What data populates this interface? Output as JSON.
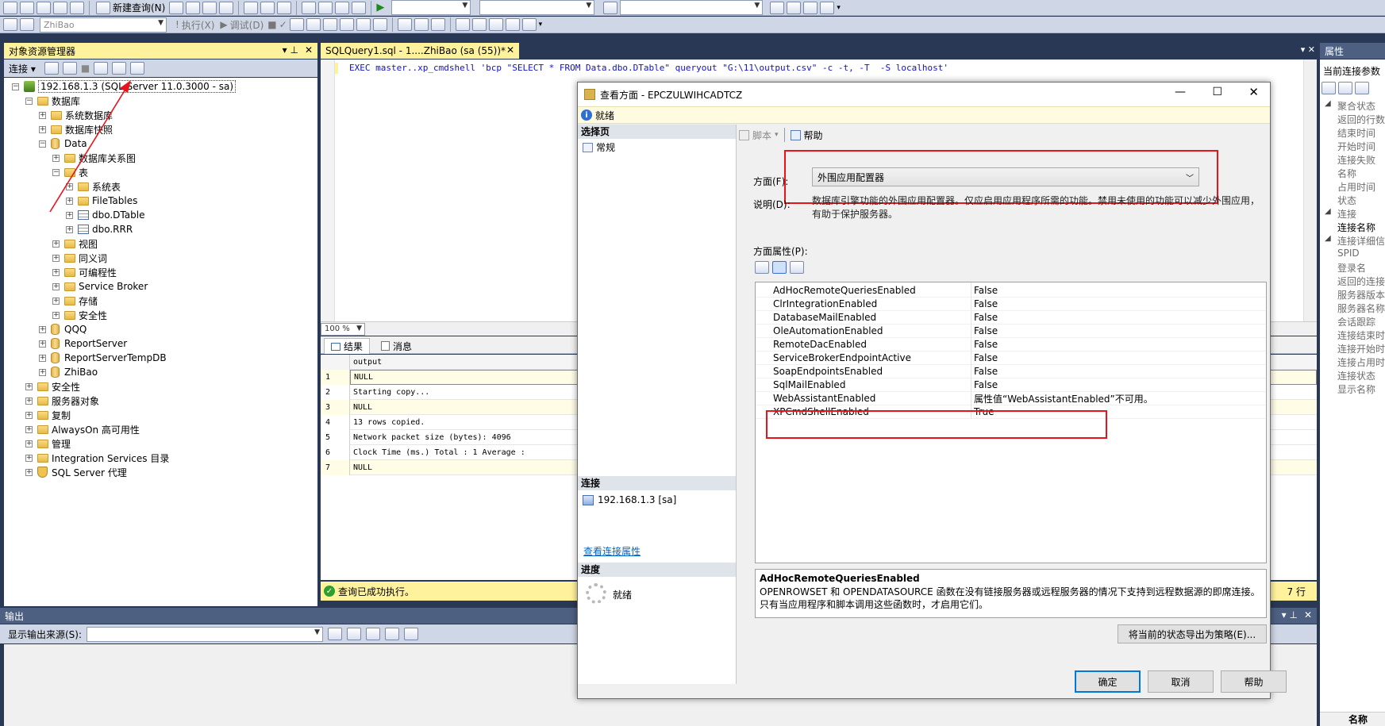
{
  "toolbar1": {
    "new_query": "新建查询(N)"
  },
  "toolbar2": {
    "database_combo": "ZhiBao",
    "execute": "执行(X)",
    "debug": "调试(D)"
  },
  "object_explorer": {
    "title": "对象资源管理器",
    "connect_label": "连接 ▾",
    "tree": [
      {
        "label": "192.168.1.3 (SQL Server 11.0.3000 - sa)",
        "level": 0,
        "icon": "server-icon",
        "state": "-"
      },
      {
        "label": "数据库",
        "level": 1,
        "icon": "folder-icon",
        "state": "-"
      },
      {
        "label": "系统数据库",
        "level": 2,
        "icon": "folder-icon",
        "state": "+"
      },
      {
        "label": "数据库快照",
        "level": 2,
        "icon": "folder-icon",
        "state": "+"
      },
      {
        "label": "Data",
        "level": 2,
        "icon": "database-icon",
        "state": "-"
      },
      {
        "label": "数据库关系图",
        "level": 3,
        "icon": "folder-icon",
        "state": "+"
      },
      {
        "label": "表",
        "level": 3,
        "icon": "folder-icon",
        "state": "-"
      },
      {
        "label": "系统表",
        "level": 4,
        "icon": "folder-icon",
        "state": "+"
      },
      {
        "label": "FileTables",
        "level": 4,
        "icon": "folder-icon",
        "state": "+"
      },
      {
        "label": "dbo.DTable",
        "level": 4,
        "icon": "table-icon",
        "state": "+"
      },
      {
        "label": "dbo.RRR",
        "level": 4,
        "icon": "table-icon",
        "state": "+"
      },
      {
        "label": "视图",
        "level": 3,
        "icon": "folder-icon",
        "state": "+"
      },
      {
        "label": "同义词",
        "level": 3,
        "icon": "folder-icon",
        "state": "+"
      },
      {
        "label": "可编程性",
        "level": 3,
        "icon": "folder-icon",
        "state": "+"
      },
      {
        "label": "Service Broker",
        "level": 3,
        "icon": "folder-icon",
        "state": "+"
      },
      {
        "label": "存储",
        "level": 3,
        "icon": "folder-icon",
        "state": "+"
      },
      {
        "label": "安全性",
        "level": 3,
        "icon": "folder-icon",
        "state": "+"
      },
      {
        "label": "QQQ",
        "level": 2,
        "icon": "database-icon",
        "state": "+"
      },
      {
        "label": "ReportServer",
        "level": 2,
        "icon": "database-icon",
        "state": "+"
      },
      {
        "label": "ReportServerTempDB",
        "level": 2,
        "icon": "database-icon",
        "state": "+"
      },
      {
        "label": "ZhiBao",
        "level": 2,
        "icon": "database-icon",
        "state": "+"
      },
      {
        "label": "安全性",
        "level": 1,
        "icon": "folder-icon",
        "state": "+"
      },
      {
        "label": "服务器对象",
        "level": 1,
        "icon": "folder-icon",
        "state": "+"
      },
      {
        "label": "复制",
        "level": 1,
        "icon": "folder-icon",
        "state": "+"
      },
      {
        "label": "AlwaysOn 高可用性",
        "level": 1,
        "icon": "folder-icon",
        "state": "+"
      },
      {
        "label": "管理",
        "level": 1,
        "icon": "folder-icon",
        "state": "+"
      },
      {
        "label": "Integration Services 目录",
        "level": 1,
        "icon": "folder-icon",
        "state": "+"
      },
      {
        "label": "SQL Server 代理",
        "level": 1,
        "icon": "agent-icon",
        "state": "+"
      }
    ]
  },
  "editor": {
    "tab_title": "SQLQuery1.sql - 1....ZhiBao (sa (55))*",
    "sql": "EXEC master..xp_cmdshell 'bcp \"SELECT * FROM Data.dbo.DTable\" queryout \"G:\\11\\output.csv\" -c -t, -T  -S localhost'",
    "zoom": "100 %"
  },
  "results": {
    "tab_results": "结果",
    "tab_messages": "消息",
    "column": "output",
    "rows": [
      {
        "n": "1",
        "v": "NULL"
      },
      {
        "n": "2",
        "v": "Starting copy..."
      },
      {
        "n": "3",
        "v": "NULL"
      },
      {
        "n": "4",
        "v": "13 rows copied."
      },
      {
        "n": "5",
        "v": "Network packet size (bytes): 4096"
      },
      {
        "n": "6",
        "v": "Clock Time (ms.) Total     : 1      Average :"
      },
      {
        "n": "7",
        "v": "NULL"
      }
    ],
    "status": "查询已成功执行。",
    "row_count": "7 行"
  },
  "output_panel": {
    "title": "输出",
    "source_label": "显示输出来源(S):"
  },
  "properties_panel": {
    "title": "属性",
    "subtitle": "当前连接参数",
    "items": [
      {
        "label": "聚合状态",
        "indent": 0
      },
      {
        "label": "返回的行数",
        "indent": 1
      },
      {
        "label": "结束时间",
        "indent": 1
      },
      {
        "label": "开始时间",
        "indent": 1
      },
      {
        "label": "连接失败",
        "indent": 1
      },
      {
        "label": "名称",
        "indent": 1
      },
      {
        "label": "占用时间",
        "indent": 1
      },
      {
        "label": "状态",
        "indent": 1
      },
      {
        "label": "连接",
        "indent": 0
      },
      {
        "label": "连接名称",
        "indent": 1
      },
      {
        "label": "连接详细信",
        "indent": 0
      },
      {
        "label": "SPID",
        "indent": 1
      },
      {
        "label": "登录名",
        "indent": 1
      },
      {
        "label": "返回的连接",
        "indent": 1
      },
      {
        "label": "服务器版本",
        "indent": 1
      },
      {
        "label": "服务器名称",
        "indent": 1
      },
      {
        "label": "会话跟踪",
        "indent": 1
      },
      {
        "label": "连接结束时",
        "indent": 1
      },
      {
        "label": "连接开始时",
        "indent": 1
      },
      {
        "label": "连接占用时",
        "indent": 1
      },
      {
        "label": "连接状态",
        "indent": 1
      },
      {
        "label": "显示名称",
        "indent": 1
      }
    ],
    "bottom_label": "名称"
  },
  "dialog": {
    "title": "查看方面 - EPCZULWIHCADTCZ",
    "status": "就绪",
    "select_page_label": "选择页",
    "page_general": "常规",
    "script_label": "脚本",
    "help_label": "帮助",
    "facet_label": "方面(F):",
    "facet_value": "外围应用配置器",
    "desc_label": "说明(D):",
    "desc_text": "数据库引擎功能的外围应用配置器。仅应启用应用程序所需的功能。禁用未使用的功能可以减少外围应用，有助于保护服务器。",
    "props_label": "方面属性(P):",
    "properties": [
      {
        "name": "AdHocRemoteQueriesEnabled",
        "value": "False"
      },
      {
        "name": "ClrIntegrationEnabled",
        "value": "False"
      },
      {
        "name": "DatabaseMailEnabled",
        "value": "False"
      },
      {
        "name": "OleAutomationEnabled",
        "value": "False"
      },
      {
        "name": "RemoteDacEnabled",
        "value": "False"
      },
      {
        "name": "ServiceBrokerEndpointActive",
        "value": "False"
      },
      {
        "name": "SoapEndpointsEnabled",
        "value": "False"
      },
      {
        "name": "SqlMailEnabled",
        "value": "False"
      },
      {
        "name": "WebAssistantEnabled",
        "value": "属性值“WebAssistantEnabled”不可用。"
      },
      {
        "name": "XPCmdShellEnabled",
        "value": "True"
      }
    ],
    "help_title": "AdHocRemoteQueriesEnabled",
    "help_text": "OPENROWSET 和 OPENDATASOURCE 函数在没有链接服务器或远程服务器的情况下支持到远程数据源的即席连接。只有当应用程序和脚本调用这些函数时，才启用它们。",
    "connection_label": "连接",
    "connection_value": "192.168.1.3 [sa]",
    "view_conn_props": "查看连接属性",
    "progress_label": "进度",
    "progress_value": "就绪",
    "export_button": "将当前的状态导出为策略(E)...",
    "ok_button": "确定",
    "cancel_button": "取消",
    "help_button": "帮助"
  },
  "colors": {
    "ide_bg": "#293955",
    "panel_header": "#4d6082",
    "active_tab": "#fff29d",
    "highlight_red": "#e8141c",
    "link": "#0066cc"
  }
}
